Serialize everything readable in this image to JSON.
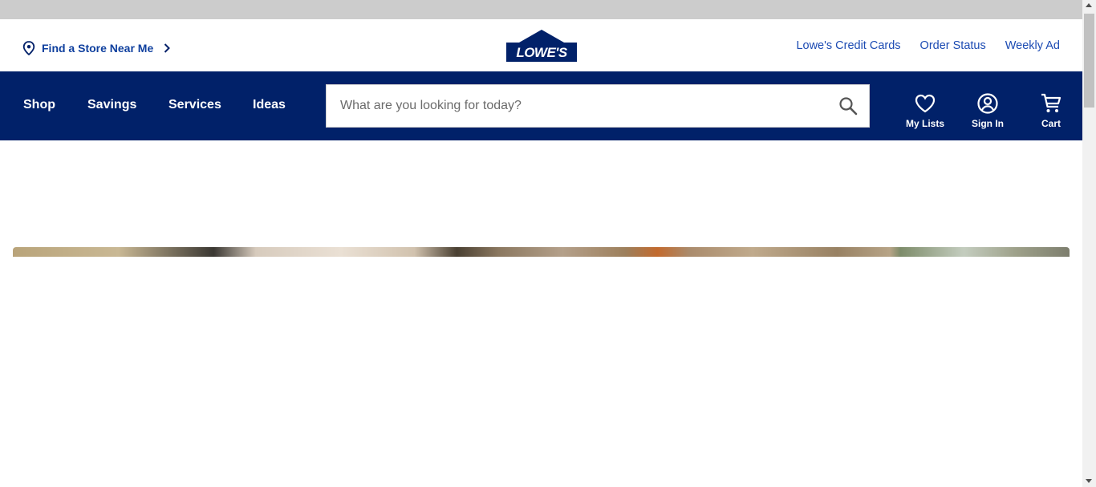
{
  "header": {
    "find_store_label": "Find a Store Near Me",
    "logo_text": "LOWE'S",
    "utility_links": [
      "Lowe's Credit Cards",
      "Order Status",
      "Weekly Ad"
    ]
  },
  "nav": {
    "items": [
      "Shop",
      "Savings",
      "Services",
      "Ideas"
    ],
    "search": {
      "placeholder": "What are you looking for today?",
      "value": ""
    },
    "my_lists_label": "My Lists",
    "sign_in_label": "Sign In",
    "cart_label": "Cart"
  },
  "icons": {
    "location": "location-pin-icon",
    "chevron": "chevron-right-icon",
    "search": "search-icon",
    "heart": "heart-icon",
    "account": "account-icon",
    "cart": "cart-icon"
  },
  "colors": {
    "brand_navy": "#012169",
    "link_blue": "#1c4bb3",
    "top_strip": "#cccccc",
    "white": "#ffffff"
  }
}
